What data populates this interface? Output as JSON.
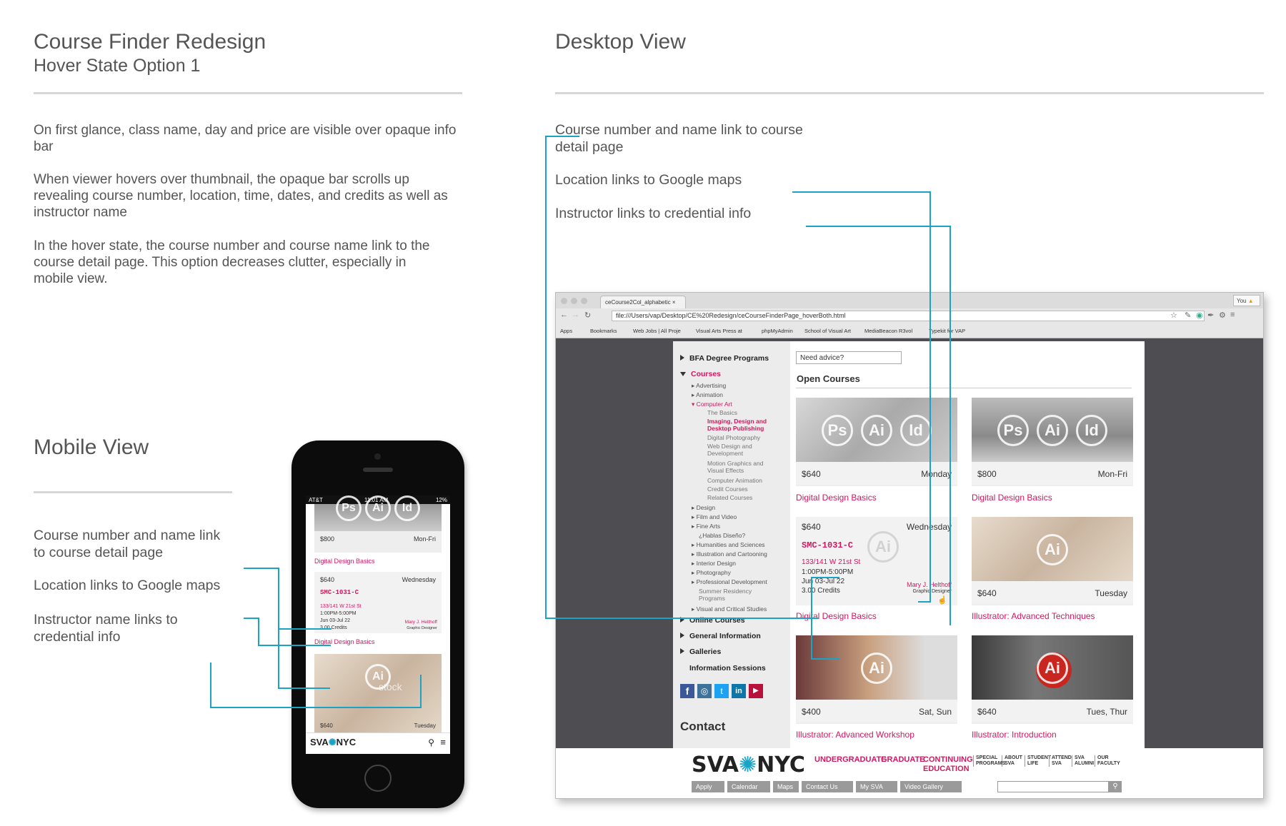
{
  "left": {
    "title": "Course Finder Redesign",
    "subtitle": "Hover State Option 1",
    "paragraphs": [
      "On first glance, class name, day and price are visible over opaque info bar",
      "When viewer hovers over thumbnail, the opaque bar scrolls up revealing course number, location, time, dates, and credits as well as instructor name",
      "In the hover state, the course number and course name link to the course detail page. This option decreases clutter, especially in mobile view."
    ]
  },
  "mobile": {
    "heading": "Mobile View",
    "notes": [
      "Course number and name link to course detail page",
      "Location links to Google maps",
      "Instructor name links to credential info"
    ],
    "status": {
      "carrier": "AT&T",
      "time": "11:01 AM",
      "battery": "12%"
    },
    "card1": {
      "price": "$800",
      "days": "Mon-Fri",
      "name": "Digital Design Basics"
    },
    "card2": {
      "price": "$640",
      "days": "Wednesday",
      "number": "SMC-1031-C",
      "location": "133/141 W 21st St",
      "time": "1:00PM-5:00PM",
      "dates": "Jun 03-Jul 22",
      "credits": "3.00 Credits",
      "instructor": "Mary J. Helthoff",
      "role": "Graphic Designer",
      "name": "Digital Design Basics"
    },
    "card3": {
      "price": "$640",
      "days": "Tuesday",
      "watermark": "stock"
    },
    "logo_left": "SVA",
    "logo_right": "NYC"
  },
  "desktop": {
    "heading": "Desktop View",
    "notes": [
      "Course number and name link to course detail page",
      "Location links to Google maps",
      "Instructor links to credential info"
    ]
  },
  "browser": {
    "tab_title": "ceCourse2Col_alphabetic",
    "you_label": "You",
    "url": "file:///Users/vap/Desktop/CE%20Redesign/ceCourseFinderPage_hoverBoth.html",
    "bookmarks": [
      "Apps",
      "Bookmarks",
      "Web Jobs | All Proje",
      "Visual Arts Press at",
      "phpMyAdmin",
      "School of Visual Art",
      "MediaBeacon R3vol",
      "Typekit for VAP"
    ]
  },
  "sidebar": {
    "items": [
      "BFA Degree Programs",
      "Courses",
      "Online Courses",
      "General Information",
      "Galleries",
      "Information Sessions"
    ],
    "course_subs": [
      "Advertising",
      "Animation",
      "Computer Art"
    ],
    "computer_art_subs": [
      "The Basics",
      "Imaging, Design and Desktop Publishing",
      "Digital Photography",
      "Web Design and Development",
      "Motion Graphics and Visual Effects",
      "Computer Animation",
      "Credit Courses",
      "Related Courses"
    ],
    "more_subs": [
      "Design",
      "Film and Video",
      "Fine Arts",
      "¿Hablas Diseño?",
      "Humanities and Sciences",
      "Illustration and Cartooning",
      "Interior Design",
      "Photography",
      "Professional Development",
      "Summer Residency Programs",
      "Visual and Critical Studies"
    ],
    "contact": "Contact"
  },
  "main": {
    "advice_placeholder": "Need advice?",
    "open_courses": "Open Courses",
    "cards": [
      {
        "price": "$640",
        "days": "Monday",
        "name": "Digital Design Basics"
      },
      {
        "price": "$800",
        "days": "Mon-Fri",
        "name": "Digital Design Basics"
      },
      {
        "price": "$640",
        "days": "Wednesday",
        "number": "SMC-1031-C",
        "location": "133/141 W 21st St",
        "time": "1:00PM-5:00PM",
        "dates": "Jun 03-Jul 22",
        "credits": "3.00 Credits",
        "instructor": "Mary J. Helthoff",
        "role": "Graphic Designer",
        "name": "Digital Design Basics"
      },
      {
        "price": "$640",
        "days": "Tuesday",
        "name": "Illustrator: Advanced Techniques"
      },
      {
        "price": "$400",
        "days": "Sat, Sun",
        "name": "Illustrator: Advanced Workshop"
      },
      {
        "price": "$640",
        "days": "Tues, Thur",
        "name": "Illustrator: Introduction"
      }
    ],
    "icons": [
      "Ps",
      "Ai",
      "Id"
    ]
  },
  "footer": {
    "logo_left": "SVA",
    "logo_right": "NYC",
    "nav": [
      "UNDERGRADUATE",
      "GRADUATE",
      "CONTINUING EDUCATION"
    ],
    "nav_small": [
      "SPECIAL PROGRAMS",
      "ABOUT SVA",
      "STUDENT LIFE",
      "ATTEND SVA",
      "SVA ALUMNI",
      "OUR FACULTY"
    ],
    "buttons": [
      "Apply",
      "Calendar",
      "Maps",
      "Contact Us",
      "My SVA",
      "Video Gallery"
    ]
  },
  "colors": {
    "accent": "#1ba3c6",
    "brand_pink": "#d1185f"
  }
}
